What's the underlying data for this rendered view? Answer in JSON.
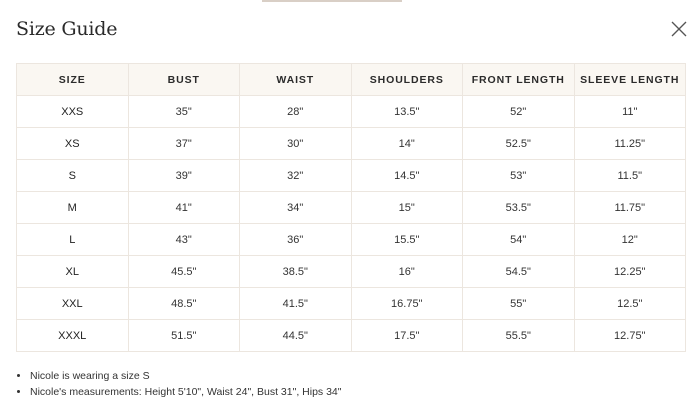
{
  "modal": {
    "title": "Size Guide",
    "close_icon": "close-icon"
  },
  "table": {
    "headers": [
      "SIZE",
      "BUST",
      "WAIST",
      "SHOULDERS",
      "FRONT LENGTH",
      "SLEEVE LENGTH"
    ],
    "rows": [
      [
        "XXS",
        "35\"",
        "28\"",
        "13.5\"",
        "52\"",
        "11\""
      ],
      [
        "XS",
        "37\"",
        "30\"",
        "14\"",
        "52.5\"",
        "11.25\""
      ],
      [
        "S",
        "39\"",
        "32\"",
        "14.5\"",
        "53\"",
        "11.5\""
      ],
      [
        "M",
        "41\"",
        "34\"",
        "15\"",
        "53.5\"",
        "11.75\""
      ],
      [
        "L",
        "43\"",
        "36\"",
        "15.5\"",
        "54\"",
        "12\""
      ],
      [
        "XL",
        "45.5\"",
        "38.5\"",
        "16\"",
        "54.5\"",
        "12.25\""
      ],
      [
        "XXL",
        "48.5\"",
        "41.5\"",
        "16.75\"",
        "55\"",
        "12.5\""
      ],
      [
        "XXXL",
        "51.5\"",
        "44.5\"",
        "17.5\"",
        "55.5\"",
        "12.75\""
      ]
    ]
  },
  "notes": [
    "Nicole is wearing a size S",
    "Nicole's measurements: Height 5'10\", Waist 24\", Bust 31\", Hips 34\""
  ],
  "colors": {
    "header_bg": "#faf7f2",
    "border": "#ece6df",
    "text": "#222222"
  }
}
